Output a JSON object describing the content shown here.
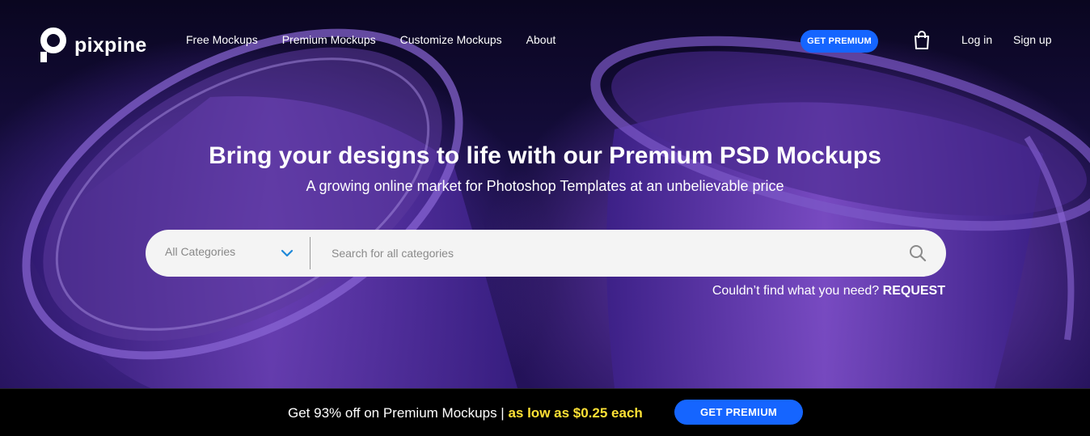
{
  "brand": {
    "name": "pixpine"
  },
  "nav": {
    "items": [
      {
        "label": "Free Mockups"
      },
      {
        "label": "Premium Mockups"
      },
      {
        "label": "Customize Mockups"
      },
      {
        "label": "About"
      }
    ]
  },
  "header": {
    "get_premium_label": "GET PREMIUM",
    "cart_icon": "shopping-bag-icon",
    "login_label": "Log in",
    "signup_label": "Sign up"
  },
  "hero": {
    "title": "Bring your designs to life with our Premium PSD Mockups",
    "subtitle": "A growing online market for Photoshop Templates at an unbelievable price"
  },
  "search": {
    "category_selected": "All Categories",
    "placeholder": "Search for all categories",
    "value": "",
    "icon": "search-icon"
  },
  "request": {
    "prompt": "Couldn’t find what you need?",
    "link_label": "REQUEST"
  },
  "promo": {
    "text": "Get 93% off on Premium Mockups |",
    "highlight": "as low as $0.25 each",
    "button_label": "GET PREMIUM"
  },
  "colors": {
    "accent": "#1565ff",
    "highlight": "#ffe135"
  }
}
